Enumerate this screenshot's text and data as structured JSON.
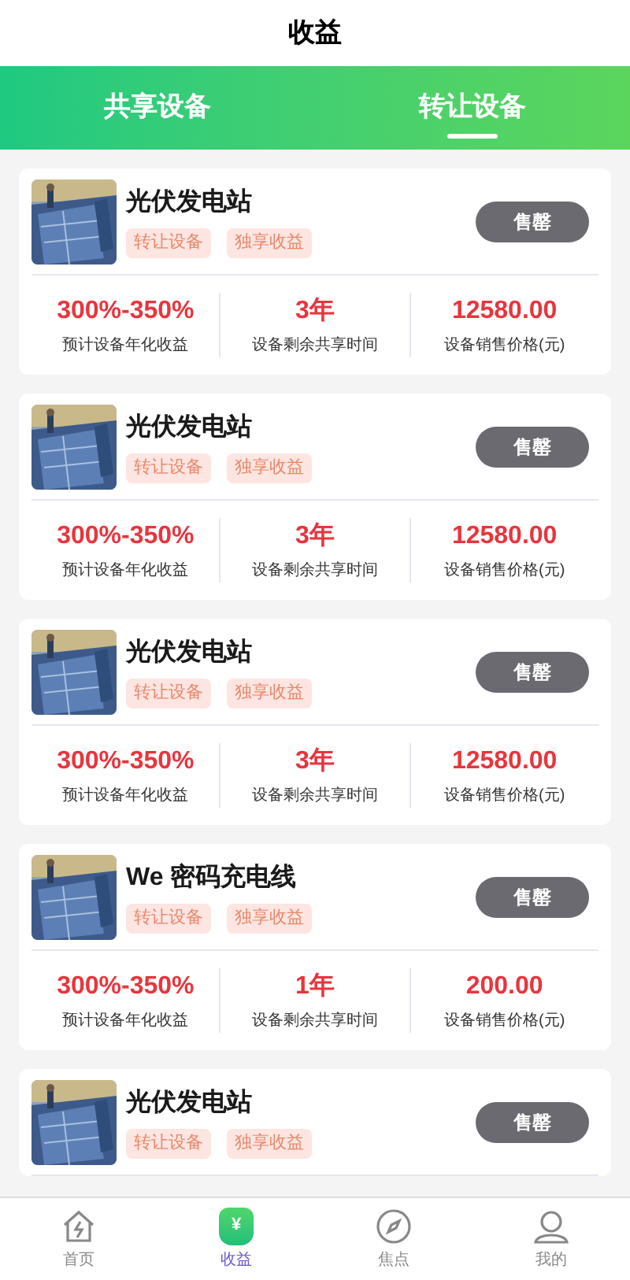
{
  "header": {
    "title": "收益"
  },
  "tabs": [
    {
      "label": "共享设备",
      "selected": false
    },
    {
      "label": "转让设备",
      "selected": true
    }
  ],
  "cards": [
    {
      "title": "光伏发电站",
      "tags": [
        "转让设备",
        "独享收益"
      ],
      "button": "售罄",
      "stats": [
        {
          "value": "300%-350%",
          "label": "预计设备年化收益"
        },
        {
          "value": "3年",
          "label": "设备剩余共享时间"
        },
        {
          "value": "12580.00",
          "label": "设备销售价格(元)"
        }
      ]
    },
    {
      "title": "光伏发电站",
      "tags": [
        "转让设备",
        "独享收益"
      ],
      "button": "售罄",
      "stats": [
        {
          "value": "300%-350%",
          "label": "预计设备年化收益"
        },
        {
          "value": "3年",
          "label": "设备剩余共享时间"
        },
        {
          "value": "12580.00",
          "label": "设备销售价格(元)"
        }
      ]
    },
    {
      "title": "光伏发电站",
      "tags": [
        "转让设备",
        "独享收益"
      ],
      "button": "售罄",
      "stats": [
        {
          "value": "300%-350%",
          "label": "预计设备年化收益"
        },
        {
          "value": "3年",
          "label": "设备剩余共享时间"
        },
        {
          "value": "12580.00",
          "label": "设备销售价格(元)"
        }
      ]
    },
    {
      "title": "We 密码充电线",
      "tags": [
        "转让设备",
        "独享收益"
      ],
      "button": "售罄",
      "stats": [
        {
          "value": "300%-350%",
          "label": "预计设备年化收益"
        },
        {
          "value": "1年",
          "label": "设备剩余共享时间"
        },
        {
          "value": "200.00",
          "label": "设备销售价格(元)"
        }
      ]
    },
    {
      "title": "光伏发电站",
      "tags": [
        "转让设备",
        "独享收益"
      ],
      "button": "售罄"
    }
  ],
  "nav": [
    {
      "kind": "home",
      "label": "首页",
      "selected": false
    },
    {
      "kind": "income",
      "label": "收益",
      "selected": true,
      "glyph": "¥"
    },
    {
      "kind": "focus",
      "label": "焦点",
      "selected": false
    },
    {
      "kind": "me",
      "label": "我的",
      "selected": false
    }
  ]
}
